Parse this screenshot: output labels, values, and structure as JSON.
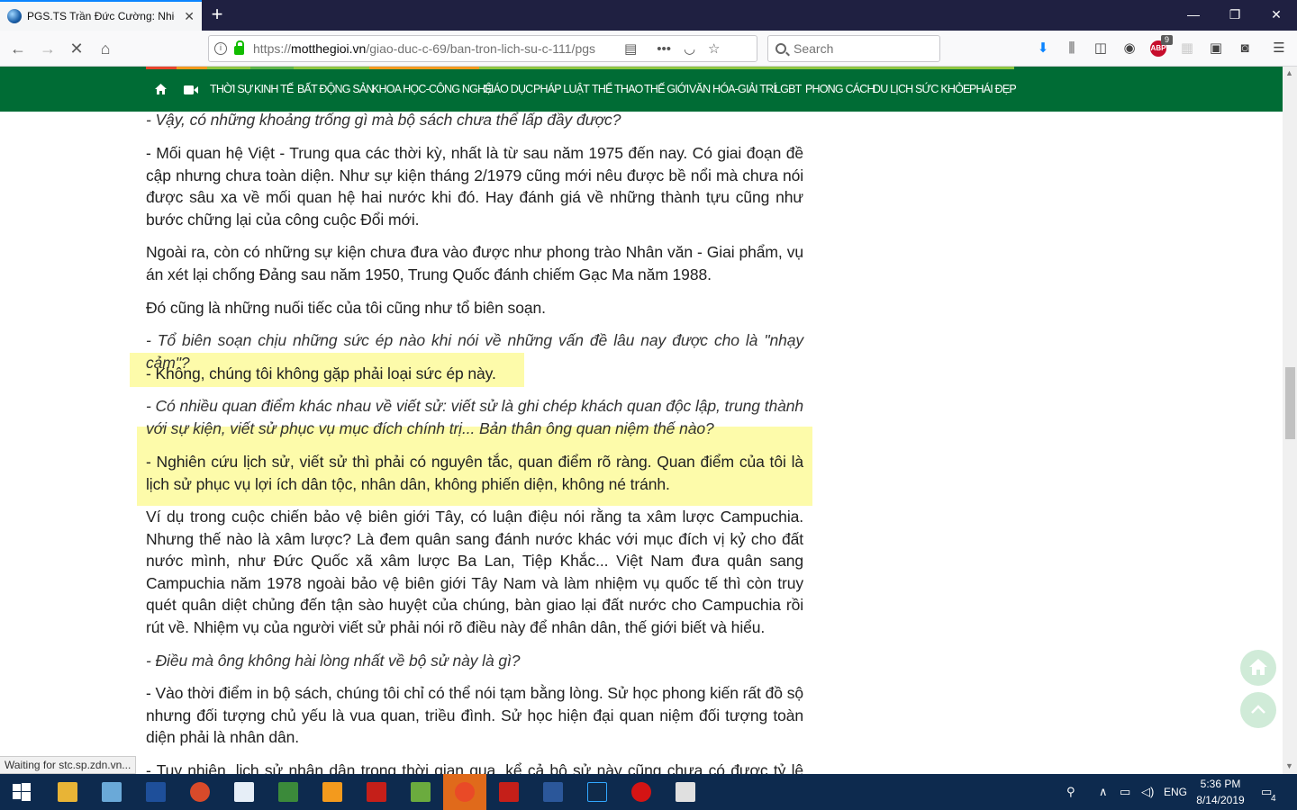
{
  "browser": {
    "tab_title": "PGS.TS Trần Đức Cường: Nhiều",
    "url_scheme": "https://",
    "url_host": "motthegioi.vn",
    "url_path": "/giao-duc-c-69/ban-tron-lich-su-c-111/pgs",
    "search_placeholder": "Search",
    "adblock_count": "9",
    "status_text": "Waiting for stc.sp.zdn.vn..."
  },
  "site_nav": {
    "items": [
      "THỜI SỰ",
      "KINH TẾ",
      "BẤT ĐỘNG SẢN",
      "KHOA HỌC-CÔNG NGHỆ",
      "GIÁO DỤC",
      "PHÁP LUẬT",
      "THỂ THAO",
      "THẾ GIỚI",
      "VĂN HÓA-GIẢI TRÍ",
      "LGBT",
      "PHONG CÁCH",
      "DU LỊCH",
      "SỨC KHỎE",
      "PHÁI ĐẸP"
    ]
  },
  "article": {
    "paragraphs": [
      {
        "text": "- Vậy, có những khoảng trống gì mà bộ sách chưa thể lấp đầy được?",
        "italic": true
      },
      {
        "text": "- Mối quan hệ Việt - Trung qua các thời kỳ, nhất là từ sau năm 1975 đến nay. Có giai đoạn đề cập nhưng chưa toàn diện. Như sự kiện tháng 2/1979 cũng mới nêu được bề nổi mà chưa nói được sâu xa về mối quan hệ hai nước khi đó. Hay đánh giá về những thành tựu cũng như bước chững lại của công cuộc Đổi mới.",
        "italic": false
      },
      {
        "text": "Ngoài ra, còn có những sự kiện chưa đưa vào được như phong trào Nhân văn - Giai phẩm, vụ án xét lại chống Đảng sau năm 1950, Trung Quốc đánh chiếm Gạc Ma năm 1988.",
        "italic": false
      },
      {
        "text": "Đó cũng là những nuối tiếc của tôi cũng như tổ biên soạn.",
        "italic": false
      },
      {
        "text": "- Tổ biên soạn chịu những sức ép nào khi nói về những vấn đề lâu nay được cho là \"nhạy cảm\"?",
        "italic": true
      },
      {
        "text": "- Không, chúng tôi không gặp phải loại sức ép này.",
        "italic": false
      },
      {
        "text": "- Có nhiều quan điểm khác nhau về viết sử: viết sử là ghi chép khách quan độc lập, trung thành với sự kiện, viết sử phục vụ mục đích chính trị... Bản thân ông quan niệm thế nào?",
        "italic": true
      },
      {
        "text": "- Nghiên cứu lịch sử, viết sử thì phải có nguyên tắc, quan điểm rõ ràng. Quan điểm của tôi là lịch sử phục vụ lợi ích dân tộc, nhân dân, không phiến diện, không né tránh.",
        "italic": false
      },
      {
        "text": "Ví dụ trong cuộc chiến bảo vệ biên giới Tây, có luận điệu nói rằng ta xâm lược Campuchia. Nhưng thế nào là xâm lược? Là đem quân sang đánh nước khác với mục đích vị kỷ cho đất nước mình, như Đức Quốc xã xâm lược Ba Lan, Tiệp Khắc... Việt Nam đưa quân sang Campuchia năm 1978 ngoài bảo vệ biên giới Tây Nam và làm nhiệm vụ quốc tế thì còn truy quét quân diệt chủng đến tận sào huyệt của chúng, bàn giao lại đất nước cho Campuchia rồi rút về. Nhiệm vụ của người viết sử phải nói rõ điều này để nhân dân, thế giới biết và hiểu.",
        "italic": false
      },
      {
        "text": "- Điều mà ông không hài lòng nhất về bộ sử này là gì?",
        "italic": true
      },
      {
        "text": "- Vào thời điểm in bộ sách, chúng tôi chỉ có thể nói tạm bằng lòng. Sử học phong kiến rất đồ sộ nhưng đối tượng chủ yếu là vua quan, triều đình. Sử học hiện đại quan niệm đối tượng toàn diện phải là nhân dân.",
        "italic": false
      },
      {
        "text": "- Tuy nhiên, lịch sử nhân dân trong thời gian qua, kể cả bộ sử này cũng chưa có được tỷ lệ thích đáng như",
        "italic": false
      }
    ]
  },
  "colors": {
    "site_nav_bg": "#006c35",
    "highlight": "#fdfbaa",
    "tab_bar_bg": "#1f2041",
    "taskbar_bg": "#0d2a4e"
  },
  "taskbar": {
    "language": "ENG",
    "time": "5:36 PM",
    "date": "8/14/2019",
    "notification_count": "4"
  }
}
